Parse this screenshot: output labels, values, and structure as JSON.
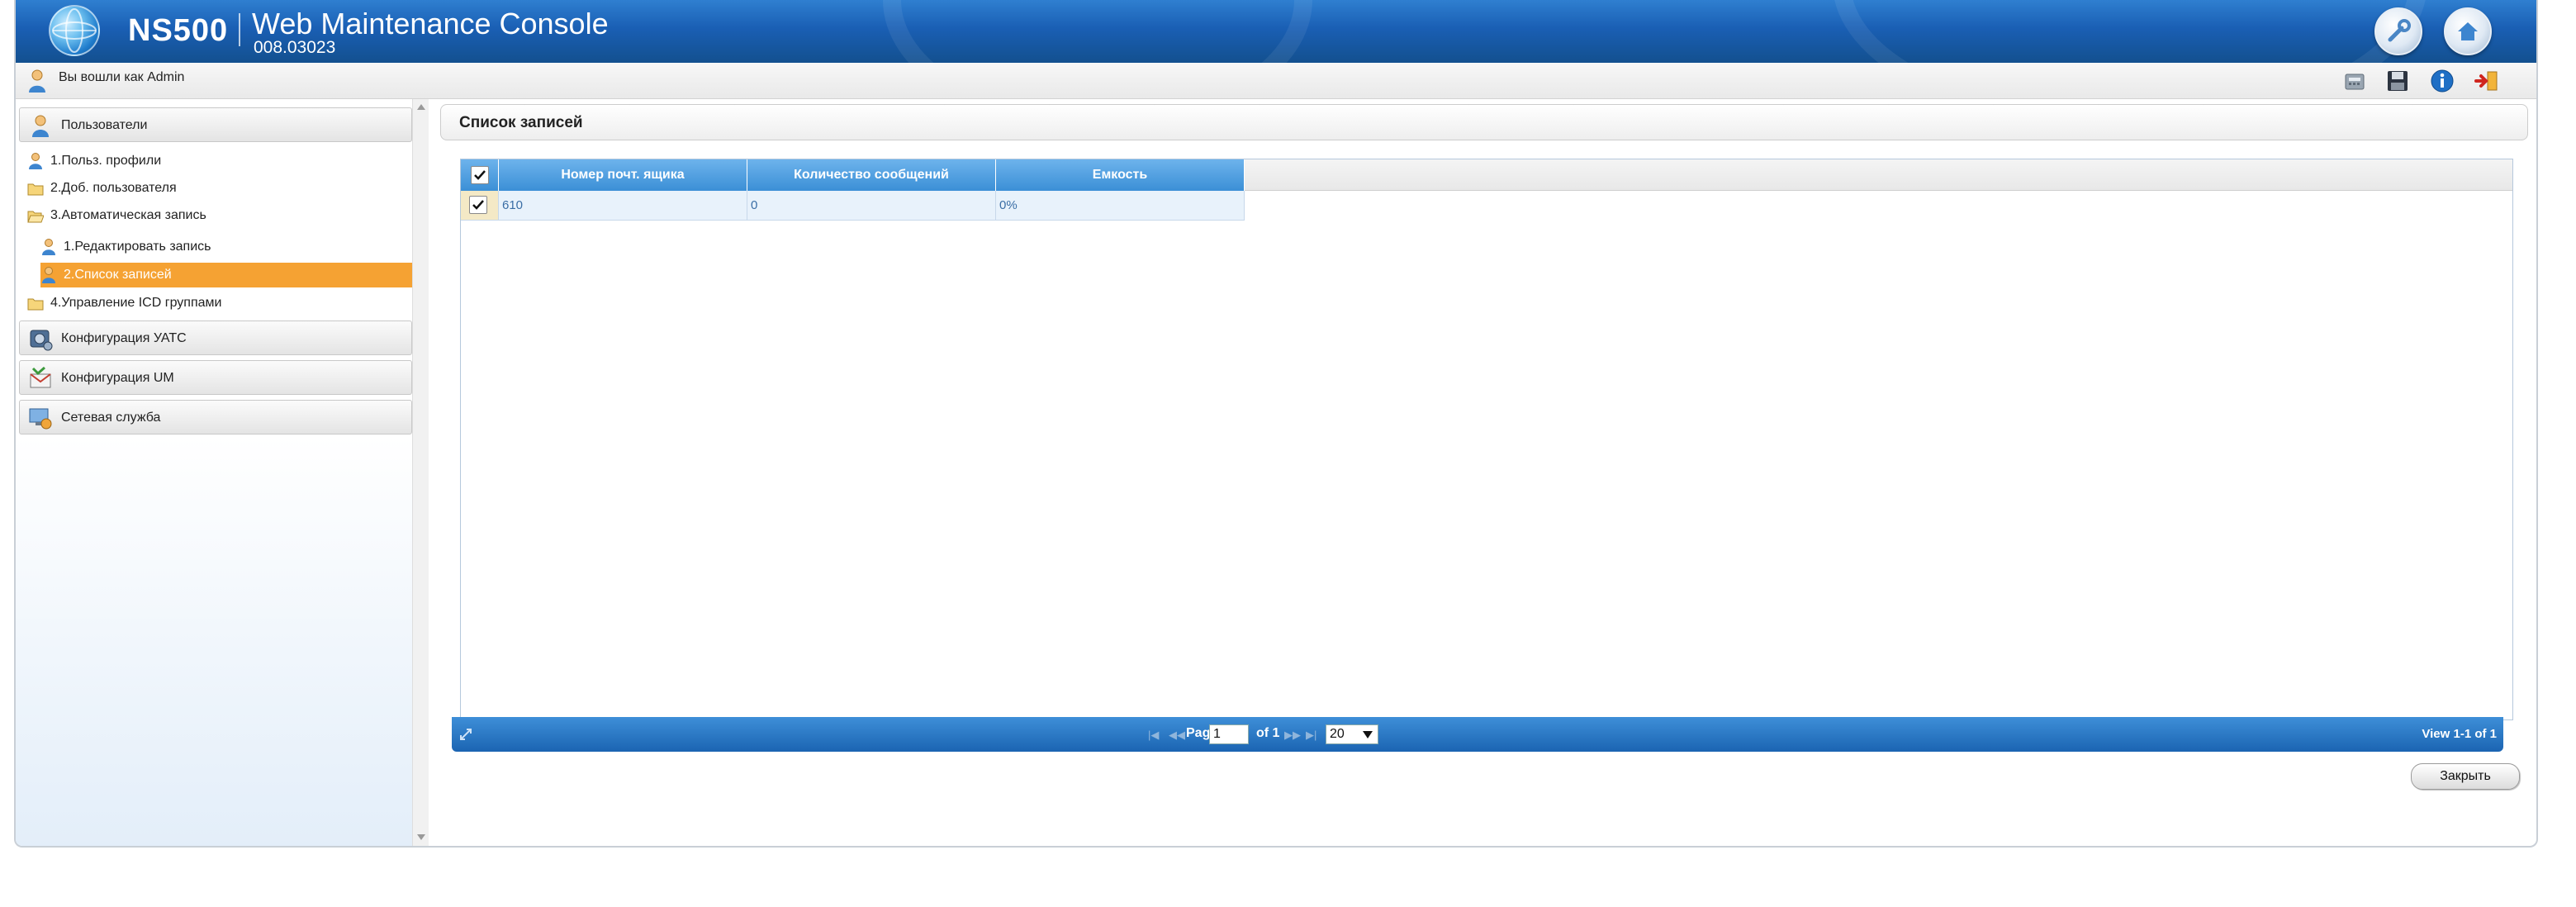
{
  "header": {
    "product_name": "NS500",
    "console_title": "Web Maintenance Console",
    "version": "008.03023",
    "buttons": [
      "wrench-icon",
      "home-icon"
    ]
  },
  "userbar": {
    "logged_in_label": "Вы вошли как Admin",
    "toolbar_icons": [
      "phone-icon",
      "save-icon",
      "info-icon",
      "logout-icon"
    ]
  },
  "sidebar": {
    "sections": [
      {
        "label": "Пользователи",
        "icon": "users-icon",
        "items": [
          {
            "label": "1.Польз. профили",
            "icon": "user-icon"
          },
          {
            "label": "2.Доб. пользователя",
            "icon": "folder-icon"
          },
          {
            "label": "3.Автоматическая запись",
            "icon": "folder-open-icon"
          },
          {
            "label": "1.Редактировать запись",
            "icon": "user-icon"
          },
          {
            "label": "2.Список записей",
            "icon": "user-icon",
            "selected": true
          },
          {
            "label": "4.Управление ICD группами",
            "icon": "folder-icon"
          }
        ]
      },
      {
        "label": "Конфигурация УАТС",
        "icon": "pbx-config-icon"
      },
      {
        "label": "Конфигурация UM",
        "icon": "um-config-icon"
      },
      {
        "label": "Сетевая служба",
        "icon": "network-service-icon"
      }
    ]
  },
  "main": {
    "title": "Список записей",
    "table": {
      "columns": [
        "Номер почт. ящика",
        "Количество сообщений",
        "Емкость"
      ],
      "rows": [
        {
          "checked": true,
          "cells": [
            "610",
            "0",
            "0%"
          ]
        }
      ]
    },
    "pager": {
      "page_label": "Page",
      "page_value": "1",
      "of_label": "of 1",
      "page_size": "20",
      "view_label": "View 1-1 of 1"
    },
    "close_label": "Закрыть"
  },
  "colors": {
    "header_blue": "#1a5fb4",
    "grid_header": "#3b8fd6",
    "selected_item": "#f5a233",
    "row_bg": "#e8f2fb"
  }
}
